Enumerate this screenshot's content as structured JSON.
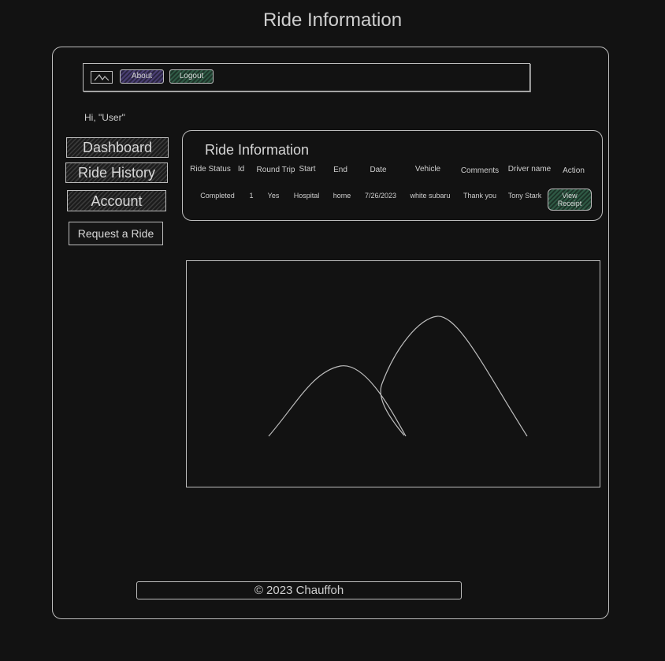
{
  "page": {
    "title": "Ride Information"
  },
  "navbar": {
    "logo_icon": "image-placeholder-icon",
    "about_label": "About",
    "logout_label": "Logout",
    "about_color": "#4a3f73",
    "logout_color": "#2f5a45"
  },
  "greeting": "Hi, \"User\"",
  "sidebar": {
    "items": [
      {
        "label": "Dashboard"
      },
      {
        "label": "Ride History"
      },
      {
        "label": "Account"
      },
      {
        "label": "Request a Ride"
      }
    ]
  },
  "ride_panel": {
    "title": "Ride Information",
    "columns": [
      "Ride Status",
      "Id",
      "Round Trip",
      "Start",
      "End",
      "Date",
      "Vehicle",
      "Comments",
      "Driver name",
      "Action"
    ],
    "rows": [
      {
        "status": "Completed",
        "id": "1",
        "round_trip": "Yes",
        "start": "Hospital",
        "end": "home",
        "date": "7/26/2023",
        "vehicle": "white subaru",
        "comments": "Thank you",
        "driver": "Tony Stark",
        "action_line1": "View",
        "action_line2": "Receipt"
      }
    ]
  },
  "image_placeholder": {
    "icon": "mountain-image-placeholder-icon"
  },
  "footer": {
    "text": "© 2023 Chauffoh"
  },
  "colors": {
    "background": "#121212",
    "stroke": "#bdbdbd",
    "accent_green": "#2f5a45",
    "accent_purple": "#4a3f73"
  }
}
